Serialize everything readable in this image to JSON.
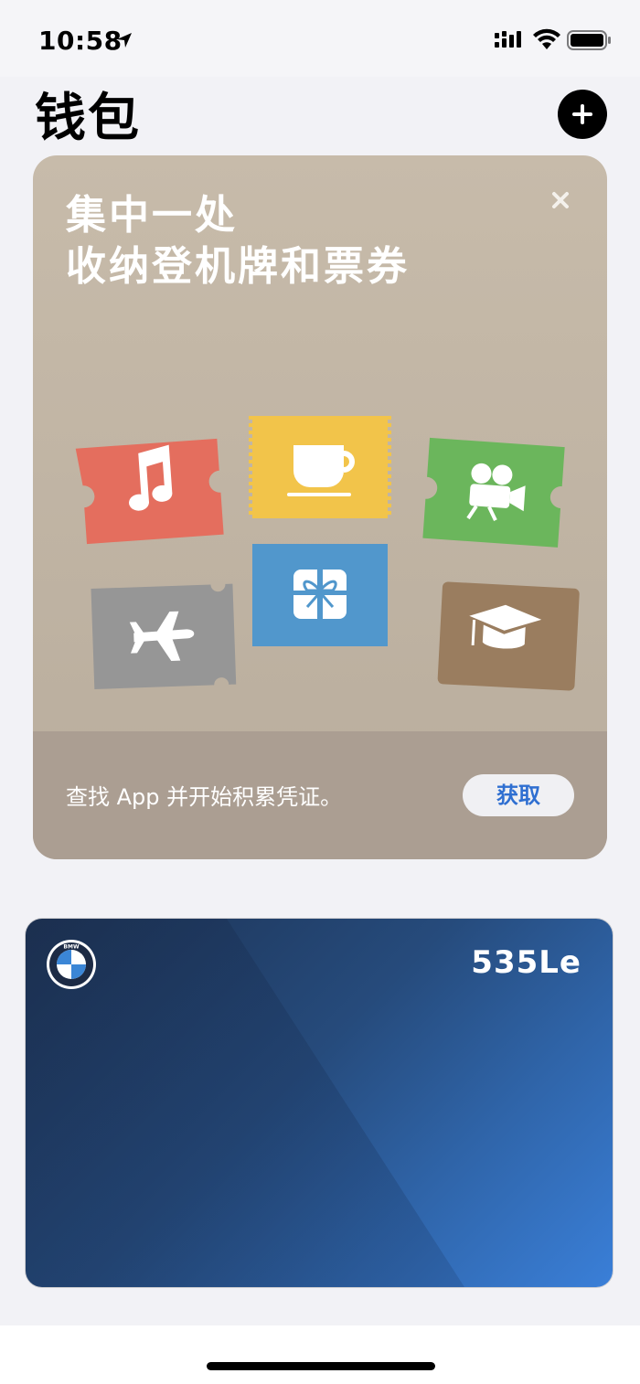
{
  "status_bar": {
    "time": "10:58",
    "icons": [
      "location-arrow-icon",
      "cellular-signal-icon",
      "wifi-icon",
      "battery-icon"
    ]
  },
  "header": {
    "title": "钱包",
    "add_icon": "plus-icon"
  },
  "promo": {
    "title_line1": "集中一处",
    "title_line2": "收纳登机牌和票券",
    "close_icon": "close-icon",
    "tickets": [
      {
        "name": "music",
        "icon": "music-note-icon",
        "color": "#e46e5e"
      },
      {
        "name": "coffee",
        "icon": "coffee-cup-icon",
        "color": "#f2c44a"
      },
      {
        "name": "movie",
        "icon": "movie-camera-icon",
        "color": "#6bb65c"
      },
      {
        "name": "flight",
        "icon": "airplane-icon",
        "color": "#969696"
      },
      {
        "name": "gift",
        "icon": "gift-icon",
        "color": "#5197cc"
      },
      {
        "name": "education",
        "icon": "graduation-cap-icon",
        "color": "#9a7d5f"
      }
    ],
    "description": "查找 App 并开始积累凭证。",
    "get_button": "获取"
  },
  "card": {
    "brand_icon": "bmw-logo-icon",
    "brand_text": "BMW",
    "model": "535Le"
  },
  "colors": {
    "accent": "#2f6fd1",
    "promo_bg": "#c1b5a5",
    "promo_footer": "#ab9e92",
    "card_dark": "#1c3152",
    "card_light": "#3a7fd8"
  }
}
